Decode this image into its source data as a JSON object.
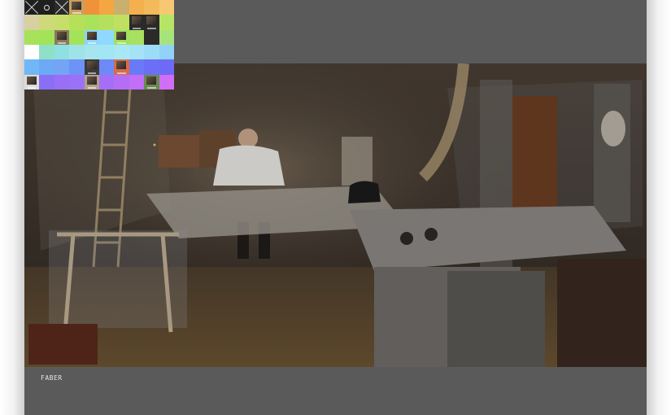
{
  "caption": {
    "text": "FABER"
  },
  "colors": {
    "frame_bg": "#5a5a5a",
    "caption_text": "#e6e6e6"
  },
  "thumbnail_grid": {
    "rows": [
      [
        "#1f1f1f",
        "#1f1f1f",
        "#2a2a2a",
        "#c8a060",
        "#f0923a",
        "#f4a642",
        "#c9b06d",
        "#f4b04c",
        "#f3b95a",
        "#f7c774"
      ],
      [
        "#d8d0a0",
        "#cdd97a",
        "#c7df6a",
        "#b7e05a",
        "#a9e35a",
        "#b4e060",
        "#bfe060",
        "#2a2a2a",
        "#2a2a2a",
        "#b6e565"
      ],
      [
        "#a6e35a",
        "#a2e35a",
        "#8a7a60",
        "#a3e35a",
        "#8fd4ff",
        "#8fd8ff",
        "#9fe060",
        "#a9e060",
        "#2a2a2a",
        "#a7e37c"
      ],
      [
        "#ffffff",
        "#8fe0c8",
        "#8fe0e0",
        "#9fe3e8",
        "#a6e4ee",
        "#a2e6f3",
        "#a8e8f6",
        "#a4e3f5",
        "#9cdcf7",
        "#92d2f8"
      ],
      [
        "#6fb7f6",
        "#6ea9f6",
        "#74a4f6",
        "#6d93f6",
        "#3a3a3a",
        "#6e8af6",
        "#d86b4a",
        "#6a7af6",
        "#6b6ff6",
        "#6f6af6"
      ],
      [
        "#dcdcdc",
        "#8a6ff6",
        "#9a6ef6",
        "#9b72f6",
        "#b4a090",
        "#a56ef6",
        "#b46ef6",
        "#c26ef6",
        "#6a8a50",
        "#d06ef6"
      ]
    ]
  }
}
